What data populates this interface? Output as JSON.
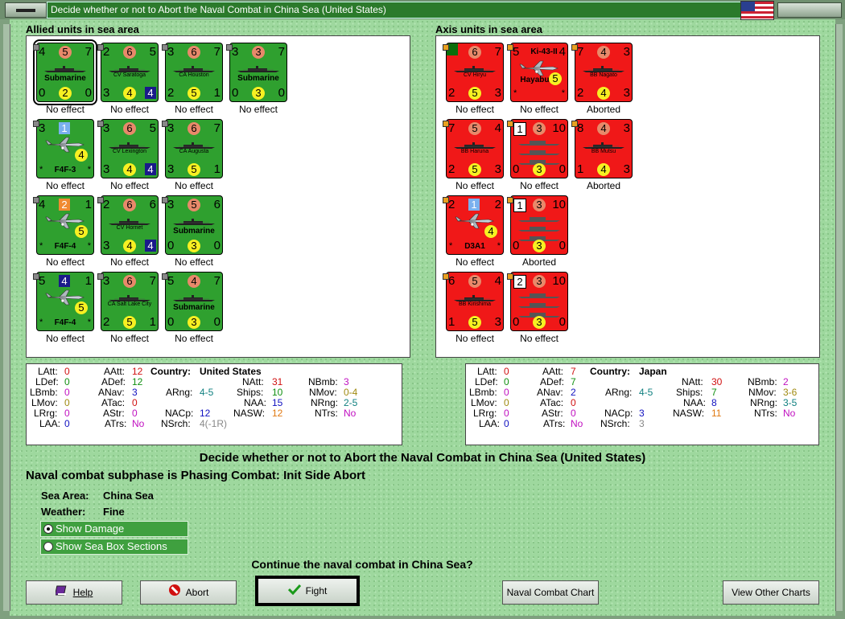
{
  "window": {
    "title": "Decide whether or not to Abort the Naval Combat in China Sea (United States)"
  },
  "allied": {
    "header": "Allied units in sea area",
    "units": [
      {
        "name": "Submarine",
        "type": "sub",
        "big": true,
        "tl": "4",
        "tc": "5",
        "tr": "7",
        "bl": "0",
        "bc": "2",
        "br": "0",
        "status": "No effect"
      },
      {
        "name": "CV Saratoga",
        "type": "ship",
        "tl": "2",
        "tc": "6",
        "tr": "5",
        "bl": "3",
        "bc": "4",
        "br": "4",
        "status": "No effect"
      },
      {
        "name": "CA Houston",
        "type": "ship",
        "tl": "3",
        "tc": "6",
        "tr": "7",
        "bl": "2",
        "bc": "5",
        "br": "1",
        "status": "No effect"
      },
      {
        "name": "Submarine",
        "type": "sub",
        "big": true,
        "tl": "3",
        "tc": "3",
        "tr": "7",
        "bl": "0",
        "bc": "3",
        "br": "0",
        "status": "No effect"
      },
      {
        "name": "F4F-3",
        "type": "plane",
        "big": true,
        "tl": "3",
        "tc": "1",
        "tr": "",
        "bl": "*",
        "bc": "4",
        "br": "*",
        "status": "No effect"
      },
      {
        "name": "CV Lexington",
        "type": "ship",
        "tl": "3",
        "tc": "6",
        "tr": "5",
        "bl": "3",
        "bc": "4",
        "br": "4",
        "status": "No effect"
      },
      {
        "name": "CA Augusta",
        "type": "ship",
        "tl": "3",
        "tc": "6",
        "tr": "7",
        "bl": "3",
        "bc": "5",
        "br": "1",
        "status": "No effect"
      },
      {
        "name": "F4F-4",
        "type": "plane",
        "big": true,
        "tl": "4",
        "tc": "2",
        "tr": "1",
        "bl": "*",
        "bc": "5",
        "br": "*",
        "status": "No effect"
      },
      {
        "name": "CV Hornet",
        "type": "ship",
        "tl": "2",
        "tc": "6",
        "tr": "6",
        "bl": "3",
        "bc": "4",
        "br": "4",
        "status": "No effect"
      },
      {
        "name": "Submarine",
        "type": "sub",
        "big": true,
        "tl": "3",
        "tc": "5",
        "tr": "6",
        "bl": "0",
        "bc": "3",
        "br": "0",
        "status": "No effect"
      },
      {
        "name": "F4F-4",
        "type": "plane",
        "big": true,
        "tl": "5",
        "tc": "4",
        "tr": "1",
        "bl": "*",
        "bc": "5",
        "br": "*",
        "status": "No effect"
      },
      {
        "name": "CA Salt Lake City",
        "type": "ship",
        "tl": "3",
        "tc": "6",
        "tr": "7",
        "bl": "2",
        "bc": "5",
        "br": "1",
        "status": "No effect"
      },
      {
        "name": "Submarine",
        "type": "sub",
        "big": true,
        "tl": "5",
        "tc": "4",
        "tr": "7",
        "bl": "0",
        "bc": "3",
        "br": "0",
        "status": "No effect"
      }
    ]
  },
  "axis": {
    "header": "Axis units in sea area",
    "units": [
      {
        "name": "CV Hiryu",
        "type": "ship",
        "tl": "2",
        "tc": "6",
        "tr": "7",
        "bl": "2",
        "bc": "5",
        "br": "3",
        "status": "No effect"
      },
      {
        "name": "Ki-43-II",
        "name2": "Hayabusa",
        "type": "plane",
        "tl": "5",
        "tc": "",
        "tr": "4",
        "bl": "*",
        "bc": "5",
        "br": "*",
        "status": "No effect"
      },
      {
        "name": "BB Nagato",
        "type": "ship",
        "tl": "7",
        "tc": "4",
        "tr": "3",
        "bl": "2",
        "bc": "4",
        "br": "3",
        "status": "Aborted"
      },
      {
        "name": "BB Haruna",
        "type": "ship",
        "tl": "7",
        "tc": "5",
        "tr": "4",
        "bl": "2",
        "bc": "5",
        "br": "3",
        "status": "No effect"
      },
      {
        "name": "",
        "type": "fleet",
        "tl": "1",
        "tc": "3",
        "tr": "10",
        "bl": "0",
        "bc": "3",
        "br": "0",
        "status": "No effect"
      },
      {
        "name": "BB Mutsu",
        "type": "ship",
        "tl": "8",
        "tc": "4",
        "tr": "3",
        "bl": "1",
        "bc": "4",
        "br": "3",
        "status": "Aborted"
      },
      {
        "name": "D3A1",
        "type": "plane",
        "big": true,
        "tl": "2",
        "tc": "1",
        "tr": "2",
        "bl": "*",
        "bc": "4",
        "br": "*",
        "status": "No effect"
      },
      {
        "name": "",
        "type": "fleet",
        "tl": "1",
        "tc": "3",
        "tr": "10",
        "bl": "0",
        "bc": "3",
        "br": "0",
        "status": "Aborted"
      },
      {
        "name": "BB Kirishima",
        "type": "ship",
        "tl": "6",
        "tc": "5",
        "tr": "4",
        "bl": "1",
        "bc": "5",
        "br": "3",
        "status": "No effect"
      },
      {
        "name": "",
        "type": "fleet",
        "tl": "2",
        "tc": "3",
        "tr": "10",
        "bl": "0",
        "bc": "3",
        "br": "0",
        "status": "No effect"
      }
    ]
  },
  "allied_stats": {
    "country_label": "Country:",
    "country": "United States",
    "LAtt": "0",
    "LDef": "0",
    "LBmb": "0",
    "LMov": "0",
    "LRrg": "0",
    "LAA": "0",
    "AAtt": "12",
    "ADef": "12",
    "ANav": "3",
    "ATac": "0",
    "AStr": "0",
    "ATrs": "No",
    "ARng": "4-5",
    "NACp": "12",
    "NSrch": "4(-1R)",
    "NAtt": "31",
    "Ships": "10",
    "NAA": "15",
    "NASW": "12",
    "NBmb": "3",
    "NMov": "0-4",
    "NRng": "2-5",
    "NTrs": "No"
  },
  "axis_stats": {
    "country_label": "Country:",
    "country": "Japan",
    "LAtt": "0",
    "LDef": "0",
    "LBmb": "0",
    "LMov": "0",
    "LRrg": "0",
    "LAA": "0",
    "AAtt": "7",
    "ADef": "7",
    "ANav": "2",
    "ATac": "0",
    "AStr": "0",
    "ATrs": "No",
    "ARng": "4-5",
    "NACp": "3",
    "NSrch": "3",
    "NAtt": "30",
    "Ships": "7",
    "NAA": "8",
    "NASW": "11",
    "NBmb": "2",
    "NMov": "3-6",
    "NRng": "3-5",
    "NTrs": "No"
  },
  "main": {
    "heading": "Decide whether or not to Abort the Naval Combat in China Sea (United States)",
    "subphase": "Naval combat subphase is Phasing Combat: Init Side Abort",
    "sea_area_label": "Sea Area:",
    "sea_area": "China Sea",
    "weather_label": "Weather:",
    "weather": "Fine",
    "show_damage": "Show Damage",
    "show_sections": "Show Sea Box Sections",
    "question": "Continue the naval combat in China Sea?"
  },
  "buttons": {
    "help": "Help",
    "abort": "Abort",
    "fight": "Fight",
    "naval_chart": "Naval Combat Chart",
    "other_charts": "View Other Charts"
  },
  "colors": {
    "allied": "#2fa02f",
    "axis": "#f01818",
    "background": "#9ed89e"
  }
}
